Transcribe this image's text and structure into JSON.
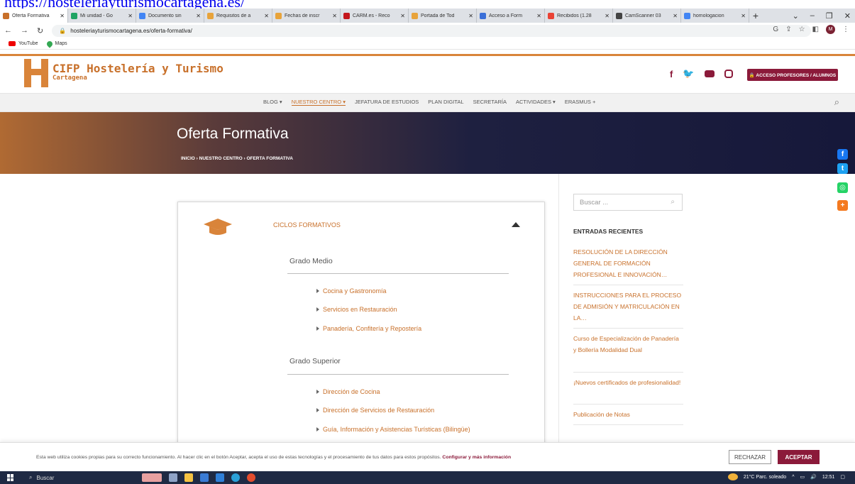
{
  "top_link": "https://hosteleriayturismocartagena.es/",
  "browser": {
    "tabs": [
      {
        "label": "Oferta Formativa",
        "color": "#c8702a",
        "active": true
      },
      {
        "label": "Mi unidad - Go",
        "color": "#1fa463"
      },
      {
        "label": "Documento sin",
        "color": "#4285f4"
      },
      {
        "label": "Requisitos de a",
        "color": "#e8a33a"
      },
      {
        "label": "Fechas de inscr",
        "color": "#e8a33a"
      },
      {
        "label": "CARM.es - Reco",
        "color": "#c4161c"
      },
      {
        "label": "Portada de Tod",
        "color": "#e8a33a"
      },
      {
        "label": "Acceso a Form",
        "color": "#3a6fd8"
      },
      {
        "label": "Recibidos (1.28",
        "color": "#ea4335"
      },
      {
        "label": "CamScanner 03",
        "color": "#444444"
      },
      {
        "label": "homologacion",
        "color": "#4285f4"
      }
    ],
    "url": "hosteleriayturismocartagena.es/oferta-formativa/",
    "avatar_letter": "M",
    "bookmarks": [
      "YouTube",
      "Maps"
    ]
  },
  "site": {
    "title": "CIFP Hostelería y Turismo",
    "subtitle": "Cartagena",
    "access_button": "🔒 ACCESO PROFESORES / ALUMNOS",
    "nav": [
      "BLOG ▾",
      "NUESTRO CENTRO ▾",
      "JEFATURA DE ESTUDIOS",
      "PLAN DIGITAL",
      "SECRETARÍA",
      "ACTIVIDADES ▾",
      "ERASMUS +"
    ],
    "hero_title": "Oferta Formativa",
    "breadcrumb": "INICIO  ›  NUESTRO CENTRO  ›  OFERTA FORMATIVA"
  },
  "card": {
    "heading": "CICLOS FORMATIVOS",
    "groups": [
      {
        "title": "Grado Medio",
        "courses": [
          "Cocina y Gastronomía",
          "Servicios en Restauración",
          "Panadería, Confitería y Repostería"
        ]
      },
      {
        "title": "Grado Superior",
        "courses": [
          "Dirección de Cocina",
          "Dirección de Servicios de Restauración",
          "Guía, Información y Asistencias Turísticas (Bilingüe)"
        ]
      }
    ]
  },
  "sidebar": {
    "search_placeholder": "Buscar ...",
    "recent_title": "ENTRADAS RECIENTES",
    "recent": [
      "RESOLUCIÓN DE LA DIRECCIÓN GENERAL DE FORMACIÓN PROFESIONAL E INNOVACIÓN…",
      "INSTRUCCIONES PARA EL PROCESO DE ADMISIÓN Y MATRICULACIÓN EN LA…",
      "Curso de Especialización de Panadería y Bollería Modalidad Dual",
      "¡Nuevos certificados de profesionalidad!",
      "Publicación de Notas"
    ]
  },
  "cookie": {
    "text": "Esta web utiliza cookies propias para su correcto funcionamiento. Al hacer clic en el botón Aceptar, acepta el uso de estas tecnologías y el procesamiento de tus datos para estos propósitos. ",
    "link": "Configurar y más información",
    "reject": "RECHAZAR",
    "accept": "ACEPTAR"
  },
  "taskbar": {
    "search": "Buscar",
    "weather": "21°C  Parc. soleado",
    "time": "12:51"
  }
}
